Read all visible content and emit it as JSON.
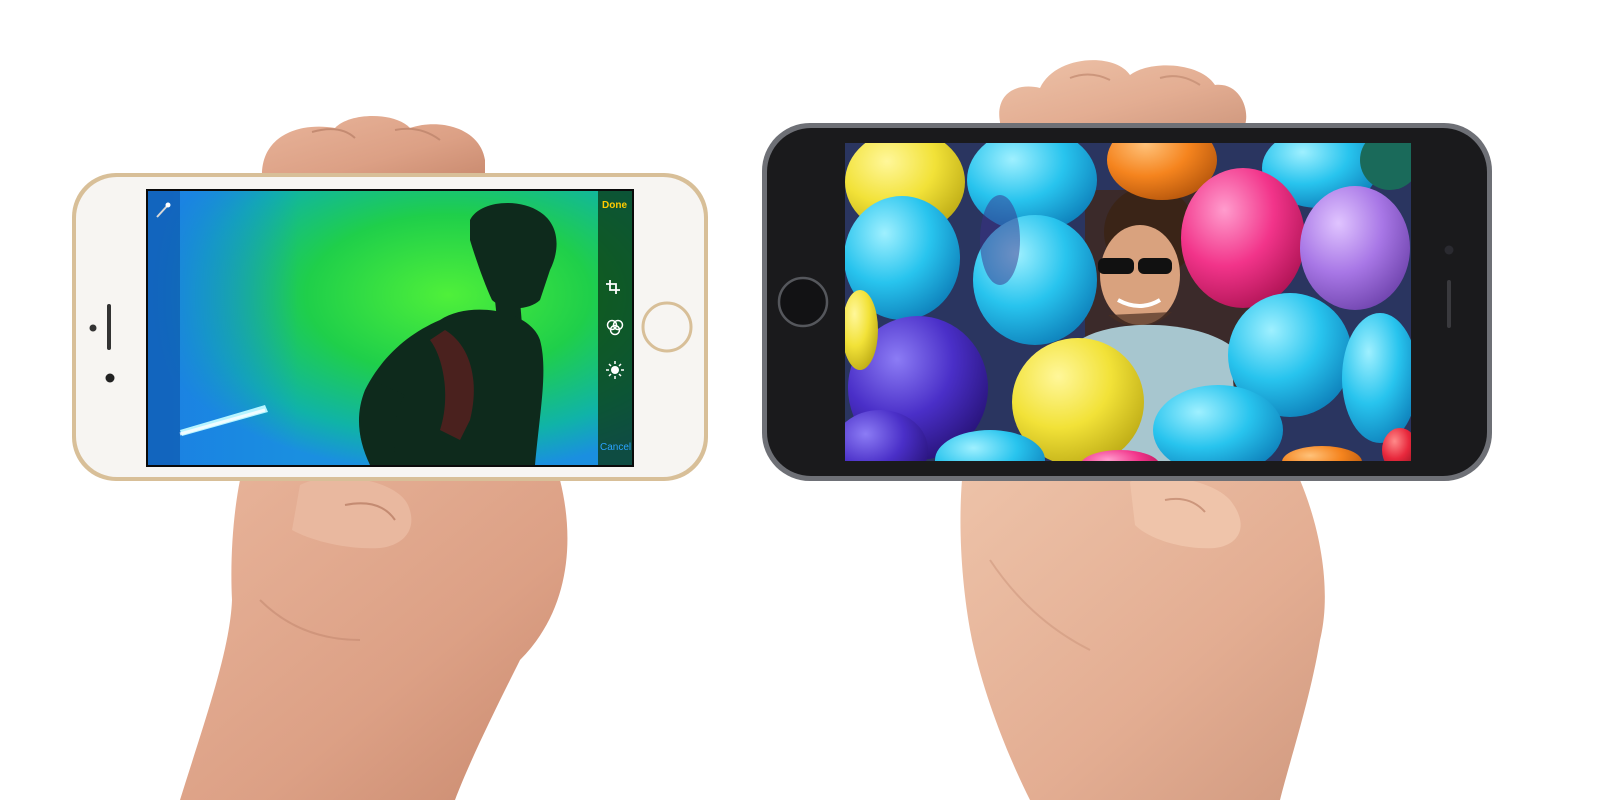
{
  "left_phone": {
    "finish": "gold",
    "body_color": "#f7f5f2",
    "bezel_color": "#d8bf98",
    "editor": {
      "done_label": "Done",
      "cancel_label": "Cancel",
      "accent_color": "#ffcc00",
      "tools": [
        "crop-icon",
        "filters-icon",
        "adjust-icon"
      ],
      "top_left_tool": "magic-wand-icon"
    }
  },
  "right_phone": {
    "finish": "space-gray",
    "body_color": "#1a1a1c",
    "bezel_color": "#6e7076"
  }
}
